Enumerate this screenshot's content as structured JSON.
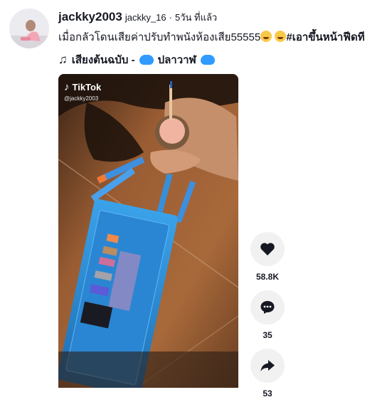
{
  "post": {
    "username": "jackky2003",
    "nickname": "jackky_16",
    "separator": "·",
    "time": "5วัน ที่แล้ว",
    "caption_text": "เมื่อกลัวโดนเสียค่าปรับทำพนังห้องเสีย55555",
    "caption_tag": "#เอาขึ้นหน้าฟีดที",
    "music_title": "เสียงต้นฉบับ - ",
    "music_artist": "ปลาวาฬ"
  },
  "video": {
    "watermark_logo": "TikTok",
    "watermark_handle": "@jackky2003"
  },
  "actions": {
    "likes": "58.8K",
    "comments": "35",
    "shares": "53"
  },
  "icons": [
    "avatar",
    "music-note-icon",
    "tiktok-logo-icon",
    "heart-icon",
    "comment-icon",
    "share-icon"
  ],
  "colors": {
    "text": "#161823",
    "action_bg": "#f1f1f2",
    "video_bg": "#6b3f22",
    "tray": "#2f8fd8"
  }
}
